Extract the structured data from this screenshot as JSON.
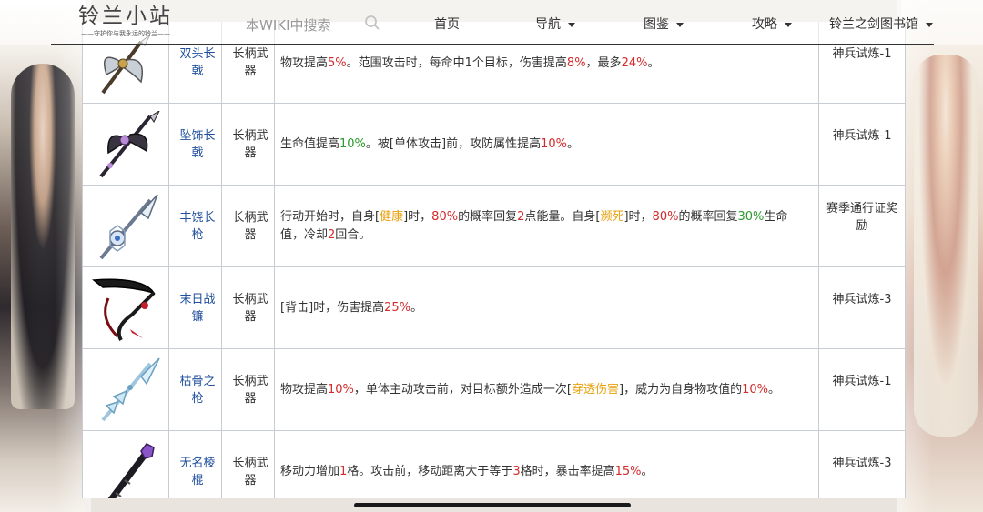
{
  "site": {
    "logo_title": "铃兰小站",
    "logo_subtitle": "——守护你与我永远的铃兰——"
  },
  "search": {
    "placeholder": "本WIKI中搜索"
  },
  "nav": {
    "home": "首页",
    "navigation": "导航",
    "catalog": "图鉴",
    "guides": "攻略",
    "library": "铃兰之剑图书馆"
  },
  "colors": {
    "value_red": "#d42a2a",
    "value_green": "#2a9a2a",
    "keyword_orange": "#e8a10c",
    "name_blue": "#1f4e9c"
  },
  "weapons": [
    {
      "icon": "double-halberd-icon",
      "name": "双头长戟",
      "type": "长柄武器",
      "effect": [
        {
          "t": "物攻提高"
        },
        {
          "t": "5%",
          "c": "red"
        },
        {
          "t": "。范围攻击时，每命中1个目标，伤害提高"
        },
        {
          "t": "8%",
          "c": "red"
        },
        {
          "t": "，最多"
        },
        {
          "t": "24%",
          "c": "red"
        },
        {
          "t": "。"
        }
      ],
      "source": "神兵试炼-1"
    },
    {
      "icon": "pendant-halberd-icon",
      "name": "坠饰长戟",
      "type": "长柄武器",
      "effect": [
        {
          "t": "生命值提高"
        },
        {
          "t": "10%",
          "c": "green"
        },
        {
          "t": "。被[单体攻击]前，攻防属性提高"
        },
        {
          "t": "10%",
          "c": "red"
        },
        {
          "t": "。"
        }
      ],
      "source": "神兵试炼-1"
    },
    {
      "icon": "bountiful-spear-icon",
      "name": "丰饶长枪",
      "type": "长柄武器",
      "effect": [
        {
          "t": "行动开始时，自身["
        },
        {
          "t": "健康",
          "c": "orange"
        },
        {
          "t": "]时，"
        },
        {
          "t": "80%",
          "c": "red"
        },
        {
          "t": "的概率回复"
        },
        {
          "t": "2",
          "c": "red"
        },
        {
          "t": "点能量。自身["
        },
        {
          "t": "濒死",
          "c": "orange"
        },
        {
          "t": "]时，"
        },
        {
          "t": "80%",
          "c": "red"
        },
        {
          "t": "的概率回复"
        },
        {
          "t": "30%",
          "c": "green"
        },
        {
          "t": "生命值，冷却"
        },
        {
          "t": "2",
          "c": "red"
        },
        {
          "t": "回合。"
        }
      ],
      "source": "赛季通行证奖励"
    },
    {
      "icon": "doom-scythe-icon",
      "name": "末日战镰",
      "type": "长柄武器",
      "effect": [
        {
          "t": "[背击]时，伤害提高"
        },
        {
          "t": "25%",
          "c": "red"
        },
        {
          "t": "。"
        }
      ],
      "source": "神兵试炼-3"
    },
    {
      "icon": "bone-spear-icon",
      "name": "枯骨之枪",
      "type": "长柄武器",
      "effect": [
        {
          "t": "物攻提高"
        },
        {
          "t": "10%",
          "c": "red"
        },
        {
          "t": "，单体主动攻击前，对目标额外造成一次["
        },
        {
          "t": "穿透伤害",
          "c": "orange"
        },
        {
          "t": "]，威力为自身物攻值的"
        },
        {
          "t": "10%",
          "c": "red"
        },
        {
          "t": "。"
        }
      ],
      "source": "神兵试炼-1"
    },
    {
      "icon": "nameless-staff-icon",
      "name": "无名棱棍",
      "type": "长柄武器",
      "effect": [
        {
          "t": "移动力增加"
        },
        {
          "t": "1",
          "c": "red"
        },
        {
          "t": "格。攻击前，移动距离大于等于"
        },
        {
          "t": "3",
          "c": "red"
        },
        {
          "t": "格时，暴击率提高"
        },
        {
          "t": "15%",
          "c": "red"
        },
        {
          "t": "。"
        }
      ],
      "source": "神兵试炼-3"
    }
  ]
}
